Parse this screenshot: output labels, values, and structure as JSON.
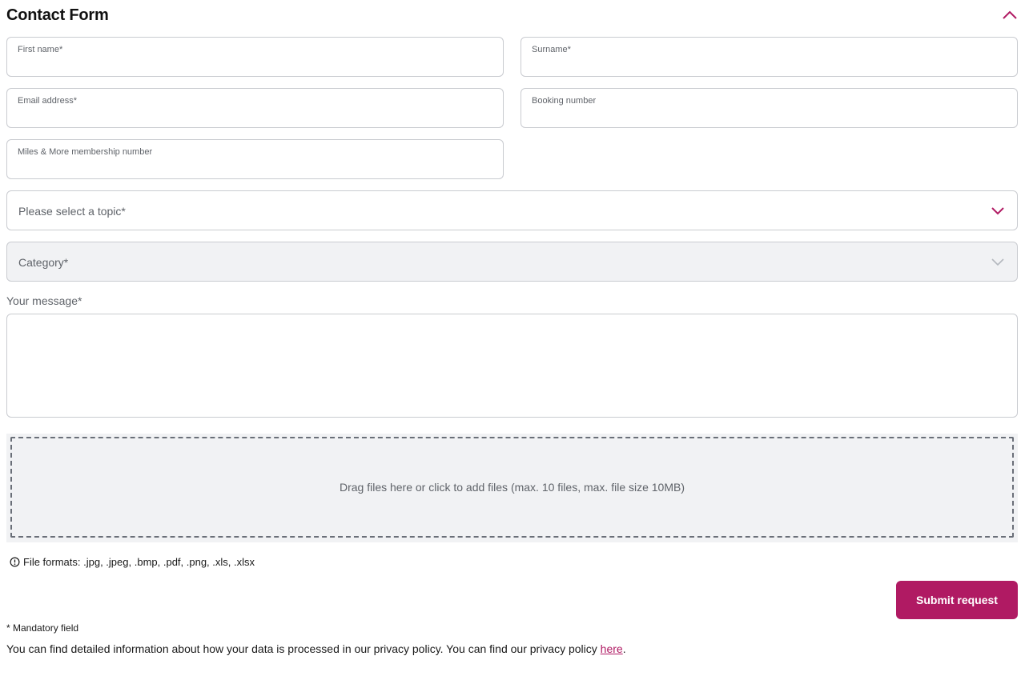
{
  "form": {
    "title": "Contact Form",
    "fields": {
      "first_name": {
        "label": "First name*",
        "value": ""
      },
      "surname": {
        "label": "Surname*",
        "value": ""
      },
      "email": {
        "label": "Email address*",
        "value": ""
      },
      "booking": {
        "label": "Booking number",
        "value": ""
      },
      "miles": {
        "label": "Miles & More membership number",
        "value": ""
      }
    },
    "topic": {
      "placeholder": "Please select a topic*"
    },
    "category": {
      "placeholder": "Category*"
    },
    "message": {
      "label": "Your message*",
      "value": ""
    },
    "dropzone": {
      "text": "Drag files here or click to add files (max. 10 files, max. file size 10MB)"
    },
    "file_formats": "File formats: .jpg, .jpeg, .bmp, .pdf, .png, .xls, .xlsx",
    "submit_label": "Submit request",
    "mandatory_note": "* Mandatory field",
    "privacy": {
      "text": "You can find detailed information about how your data is processed in our privacy policy. You can find our privacy policy ",
      "link": "here",
      "end": "."
    }
  },
  "icons": {
    "collapse": "chevron-up-icon",
    "topic_dropdown": "chevron-down-icon",
    "category_dropdown": "chevron-down-icon",
    "info": "info-circle-icon"
  },
  "colors": {
    "accent": "#b01a63",
    "disabled_bg": "#f1f2f4",
    "border": "#c9cbd0"
  }
}
